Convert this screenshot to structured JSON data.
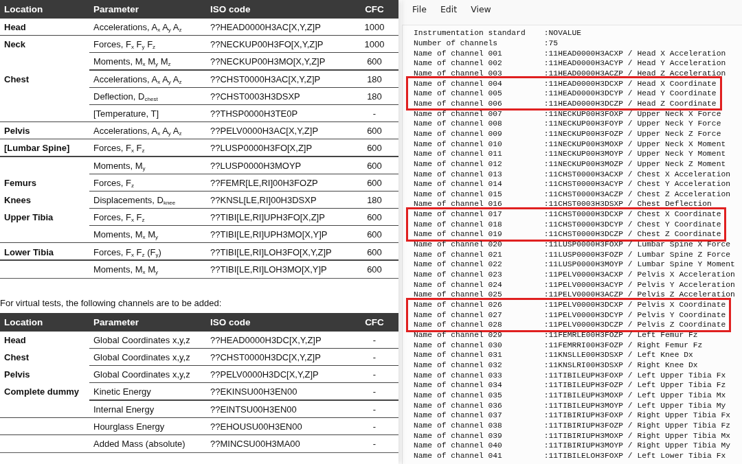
{
  "document": {
    "table_1": {
      "columns": [
        "Location",
        "Parameter",
        "ISO code",
        "CFC"
      ],
      "groups": [
        {
          "rows": [
            {
              "location": "Head",
              "parameter": "Accelerations, A$_{x}$ A$_{y}$ A$_{z}$",
              "iso_code": "??HEAD0000H3AC[X,Y,Z]P",
              "cfc": "1000"
            }
          ]
        },
        {
          "rows": [
            {
              "location": "Neck",
              "parameter": "Forces, F$_{x}$ F$_{y}$ F$_{z}$",
              "iso_code": "??NECKUP00H3FO[X,Y,Z]P",
              "cfc": "1000"
            },
            {
              "parameter": "Moments, M$_{x}$ M$_{y}$ M$_{z}$",
              "iso_code": "??NECKUP00H3MO[X,Y,Z]P",
              "cfc": "600"
            },
            {
              "location": "Chest",
              "parameter": "Accelerations, A$_{x}$ A$_{y}$ A$_{z}$",
              "iso_code": "??CHST0000H3AC[X,Y,Z]P",
              "cfc": "180"
            },
            {
              "parameter": "Deflection, D$_{chest}$",
              "iso_code": "??CHST0003H3DSXP",
              "cfc": "180"
            },
            {
              "parameter": "[Temperature, T]",
              "iso_code": "??THSP0000H3TE0P",
              "cfc": "-"
            }
          ]
        },
        {
          "rows": [
            {
              "location": "Pelvis",
              "parameter": "Accelerations, A$_{x}$ A$_{y}$ A$_{z}$",
              "iso_code": "??PELV0000H3AC[X,Y,Z]P",
              "cfc": "600"
            }
          ]
        },
        {
          "rows": [
            {
              "location": "[Lumbar Spine]",
              "parameter": "Forces, F$_{x}$ F$_{z}$",
              "iso_code": "??LUSP0000H3FO[X,Z]P",
              "cfc": "600"
            }
          ]
        },
        {
          "rows": [
            {
              "parameter": "Moments, M$_{y}$",
              "iso_code": "??LUSP0000H3MOYP",
              "cfc": "600"
            },
            {
              "location": "Femurs",
              "parameter": "Forces, F$_{z}$",
              "iso_code": "??FEMR[LE,RI]00H3FOZP",
              "cfc": "600"
            },
            {
              "location": "Knees",
              "parameter": "Displacements, D$_{knee}$",
              "iso_code": "??KNSL[LE,RI]00H3DSXP",
              "cfc": "180"
            },
            {
              "location": "Upper Tibia",
              "parameter": "Forces, F$_{x}$ F$_{z}$",
              "iso_code": "??TIBI[LE,RI]UPH3FO[X,Z]P",
              "cfc": "600"
            },
            {
              "parameter": "Moments, M$_{x}$ M$_{y}$",
              "iso_code": "??TIBI[LE,RI]UPH3MO[X,Y]P",
              "cfc": "600"
            }
          ]
        },
        {
          "rows": [
            {
              "location": "Lower Tibia",
              "parameter": "Forces, F$_{x}$ F$_{z}$ (F$_{y}$)",
              "iso_code": "??TIBI[LE,RI]LOH3FO[X,Y,Z]P",
              "cfc": "600"
            }
          ]
        },
        {
          "rows": [
            {
              "parameter": "Moments, M$_{x}$ M$_{y}$",
              "iso_code": "??TIBI[LE,RI]LOH3MO[X,Y]P",
              "cfc": "600"
            }
          ]
        }
      ]
    },
    "note": "For virtual tests, the following channels are to be added:",
    "table_2": {
      "columns": [
        "Location",
        "Parameter",
        "ISO code",
        "CFC"
      ],
      "groups": [
        {
          "rows": [
            {
              "location": "Head",
              "parameter": "Global Coordinates x,y,z",
              "iso_code": "??HEAD0000H3DC[X,Y,Z]P",
              "cfc": "-"
            },
            {
              "location": "Chest",
              "parameter": "Global Coordinates x,y,z",
              "iso_code": "??CHST0000H3DC[X,Y,Z]P",
              "cfc": "-"
            },
            {
              "location": "Pelvis",
              "parameter": "Global Coordinates x,y,z",
              "iso_code": "??PELV0000H3DC[X,Y,Z]P",
              "cfc": "-"
            },
            {
              "location": "Complete dummy",
              "parameter": "Kinetic Energy",
              "iso_code": "??EKINSU00H3EN00",
              "cfc": "-"
            },
            {
              "parameter": "Internal Energy",
              "iso_code": "??EINTSU00H3EN00",
              "cfc": "-"
            }
          ]
        },
        {
          "rows": [
            {
              "parameter": "Hourglass Energy",
              "iso_code": "??EHOUSU00H3EN00",
              "cfc": "-"
            }
          ]
        },
        {
          "rows": [
            {
              "parameter": "Added Mass (absolute)",
              "iso_code": "??MINCSU00H3MA00",
              "cfc": "-"
            }
          ]
        }
      ]
    }
  },
  "notepad": {
    "menu": [
      "File",
      "Edit",
      "View"
    ],
    "lines": [
      {
        "label": "Instrumentation standard",
        "value": ":NOVALUE",
        "highlighted": false
      },
      {
        "label": "Number of channels",
        "value": ":75",
        "highlighted": false
      },
      {
        "label": "Name of channel 001",
        "value": ":11HEAD0000H3ACXP / Head X Acceleration",
        "highlighted": false
      },
      {
        "label": "Name of channel 002",
        "value": ":11HEAD0000H3ACYP / Head Y Acceleration",
        "highlighted": false
      },
      {
        "label": "Name of channel 003",
        "value": ":11HEAD0000H3ACZP / Head Z Acceleration",
        "highlighted": false
      },
      {
        "label": "Name of channel 004",
        "value": ":11HEAD0000H3DCXP / Head X Coordinate",
        "highlighted": true
      },
      {
        "label": "Name of channel 005",
        "value": ":11HEAD0000H3DCYP / Head Y Coordinate",
        "highlighted": true
      },
      {
        "label": "Name of channel 006",
        "value": ":11HEAD0000H3DCZP / Head Z Coordinate",
        "highlighted": true
      },
      {
        "label": "Name of channel 007",
        "value": ":11NECKUP00H3FOXP / Upper Neck X Force",
        "highlighted": false
      },
      {
        "label": "Name of channel 008",
        "value": ":11NECKUP00H3FOYP / Upper Neck Y Force",
        "highlighted": false
      },
      {
        "label": "Name of channel 009",
        "value": ":11NECKUP00H3FOZP / Upper Neck Z Force",
        "highlighted": false
      },
      {
        "label": "Name of channel 010",
        "value": ":11NECKUP00H3MOXP / Upper Neck X Moment",
        "highlighted": false
      },
      {
        "label": "Name of channel 011",
        "value": ":11NECKUP00H3MOYP / Upper Neck Y Moment",
        "highlighted": false
      },
      {
        "label": "Name of channel 012",
        "value": ":11NECKUP00H3MOZP / Upper Neck Z Moment",
        "highlighted": false
      },
      {
        "label": "Name of channel 013",
        "value": ":11CHST0000H3ACXP / Chest X Acceleration",
        "highlighted": false
      },
      {
        "label": "Name of channel 014",
        "value": ":11CHST0000H3ACYP / Chest Y Acceleration",
        "highlighted": false
      },
      {
        "label": "Name of channel 015",
        "value": ":11CHST0000H3ACZP / Chest Z Acceleration",
        "highlighted": false
      },
      {
        "label": "Name of channel 016",
        "value": ":11CHST0003H3DSXP / Chest Deflection",
        "highlighted": false
      },
      {
        "label": "Name of channel 017",
        "value": ":11CHST0000H3DCXP / Chest X Coordinate",
        "highlighted": true
      },
      {
        "label": "Name of channel 018",
        "value": ":11CHST0000H3DCYP / Chest Y Coordinate",
        "highlighted": true
      },
      {
        "label": "Name of channel 019",
        "value": ":11CHST0000H3DCZP / Chest Z Coordinate",
        "highlighted": true
      },
      {
        "label": "Name of channel 020",
        "value": ":11LUSP0000H3FOXP / Lumbar Spine X Force",
        "highlighted": false
      },
      {
        "label": "Name of channel 021",
        "value": ":11LUSP0000H3FOZP / Lumbar Spine Z Force",
        "highlighted": false
      },
      {
        "label": "Name of channel 022",
        "value": ":11LUSP0000H3MOYP / Lumbar Spine Y Moment",
        "highlighted": false
      },
      {
        "label": "Name of channel 023",
        "value": ":11PELV0000H3ACXP / Pelvis X Acceleration",
        "highlighted": false
      },
      {
        "label": "Name of channel 024",
        "value": ":11PELV0000H3ACYP / Pelvis Y Acceleration",
        "highlighted": false
      },
      {
        "label": "Name of channel 025",
        "value": ":11PELV0000H3ACZP / Pelvis Z Acceleration",
        "highlighted": false
      },
      {
        "label": "Name of channel 026",
        "value": ":11PELV0000H3DCXP / Pelvis X Coordinate",
        "highlighted": true
      },
      {
        "label": "Name of channel 027",
        "value": ":11PELV0000H3DCYP / Pelvis Y Coordinate",
        "highlighted": true
      },
      {
        "label": "Name of channel 028",
        "value": ":11PELV0000H3DCZP / Pelvis Z Coordinate",
        "highlighted": true
      },
      {
        "label": "Name of channel 029",
        "value": ":11FEMRLE00H3FOZP / Left Femur Fz",
        "highlighted": false
      },
      {
        "label": "Name of channel 030",
        "value": ":11FEMRRI00H3FOZP / Right Femur Fz",
        "highlighted": false
      },
      {
        "label": "Name of channel 031",
        "value": ":11KNSLLE00H3DSXP / Left Knee Dx",
        "highlighted": false
      },
      {
        "label": "Name of channel 032",
        "value": ":11KNSLRI00H3DSXP / Right Knee Dx",
        "highlighted": false
      },
      {
        "label": "Name of channel 033",
        "value": ":11TIBILEUPH3FOXP / Left Upper Tibia Fx",
        "highlighted": false
      },
      {
        "label": "Name of channel 034",
        "value": ":11TIBILEUPH3FOZP / Left Upper Tibia Fz",
        "highlighted": false
      },
      {
        "label": "Name of channel 035",
        "value": ":11TIBILEUPH3MOXP / Left Upper Tibia Mx",
        "highlighted": false
      },
      {
        "label": "Name of channel 036",
        "value": ":11TIBILEUPH3MOYP / Left Upper Tibia My",
        "highlighted": false
      },
      {
        "label": "Name of channel 037",
        "value": ":11TIBIRIUPH3FOXP / Right Upper Tibia Fx",
        "highlighted": false
      },
      {
        "label": "Name of channel 038",
        "value": ":11TIBIRIUPH3FOZP / Right Upper Tibia Fz",
        "highlighted": false
      },
      {
        "label": "Name of channel 039",
        "value": ":11TIBIRIUPH3MOXP / Right Upper Tibia Mx",
        "highlighted": false
      },
      {
        "label": "Name of channel 040",
        "value": ":11TIBIRIUPH3MOYP / Right Upper Tibia My",
        "highlighted": false
      },
      {
        "label": "Name of channel 041",
        "value": ":11TIBILELOH3FOXP / Left Lower Tibia Fx",
        "highlighted": false
      }
    ]
  }
}
